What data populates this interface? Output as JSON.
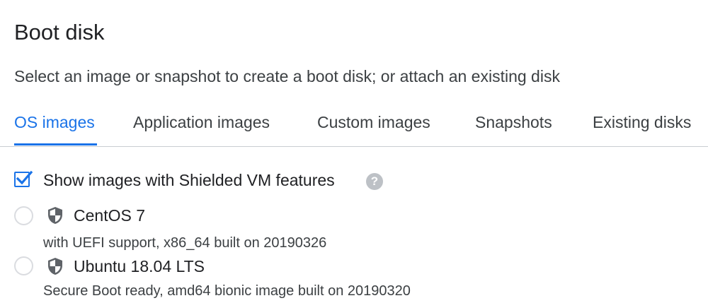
{
  "header": {
    "title": "Boot disk",
    "subtitle": "Select an image or snapshot to create a boot disk; or attach an existing disk"
  },
  "tabs": [
    {
      "label": "OS images",
      "active": true
    },
    {
      "label": "Application images",
      "active": false
    },
    {
      "label": "Custom images",
      "active": false
    },
    {
      "label": "Snapshots",
      "active": false
    },
    {
      "label": "Existing disks",
      "active": false
    }
  ],
  "filter": {
    "label": "Show images with Shielded VM features",
    "checked": true,
    "help_icon": "help-icon",
    "help_glyph": "?"
  },
  "images": [
    {
      "name": "CentOS 7",
      "description": "with UEFI support, x86_64 built on 20190326",
      "selected": false,
      "icon": "shield-icon"
    },
    {
      "name": "Ubuntu 18.04 LTS",
      "description": "Secure Boot ready, amd64 bionic image built on 20190320",
      "selected": false,
      "icon": "shield-icon"
    }
  ],
  "colors": {
    "accent": "#1a73e8",
    "text_primary": "#202124",
    "text_secondary": "#3c4043",
    "icon_gray": "#5f6368",
    "help_gray": "#bdc1c6"
  }
}
